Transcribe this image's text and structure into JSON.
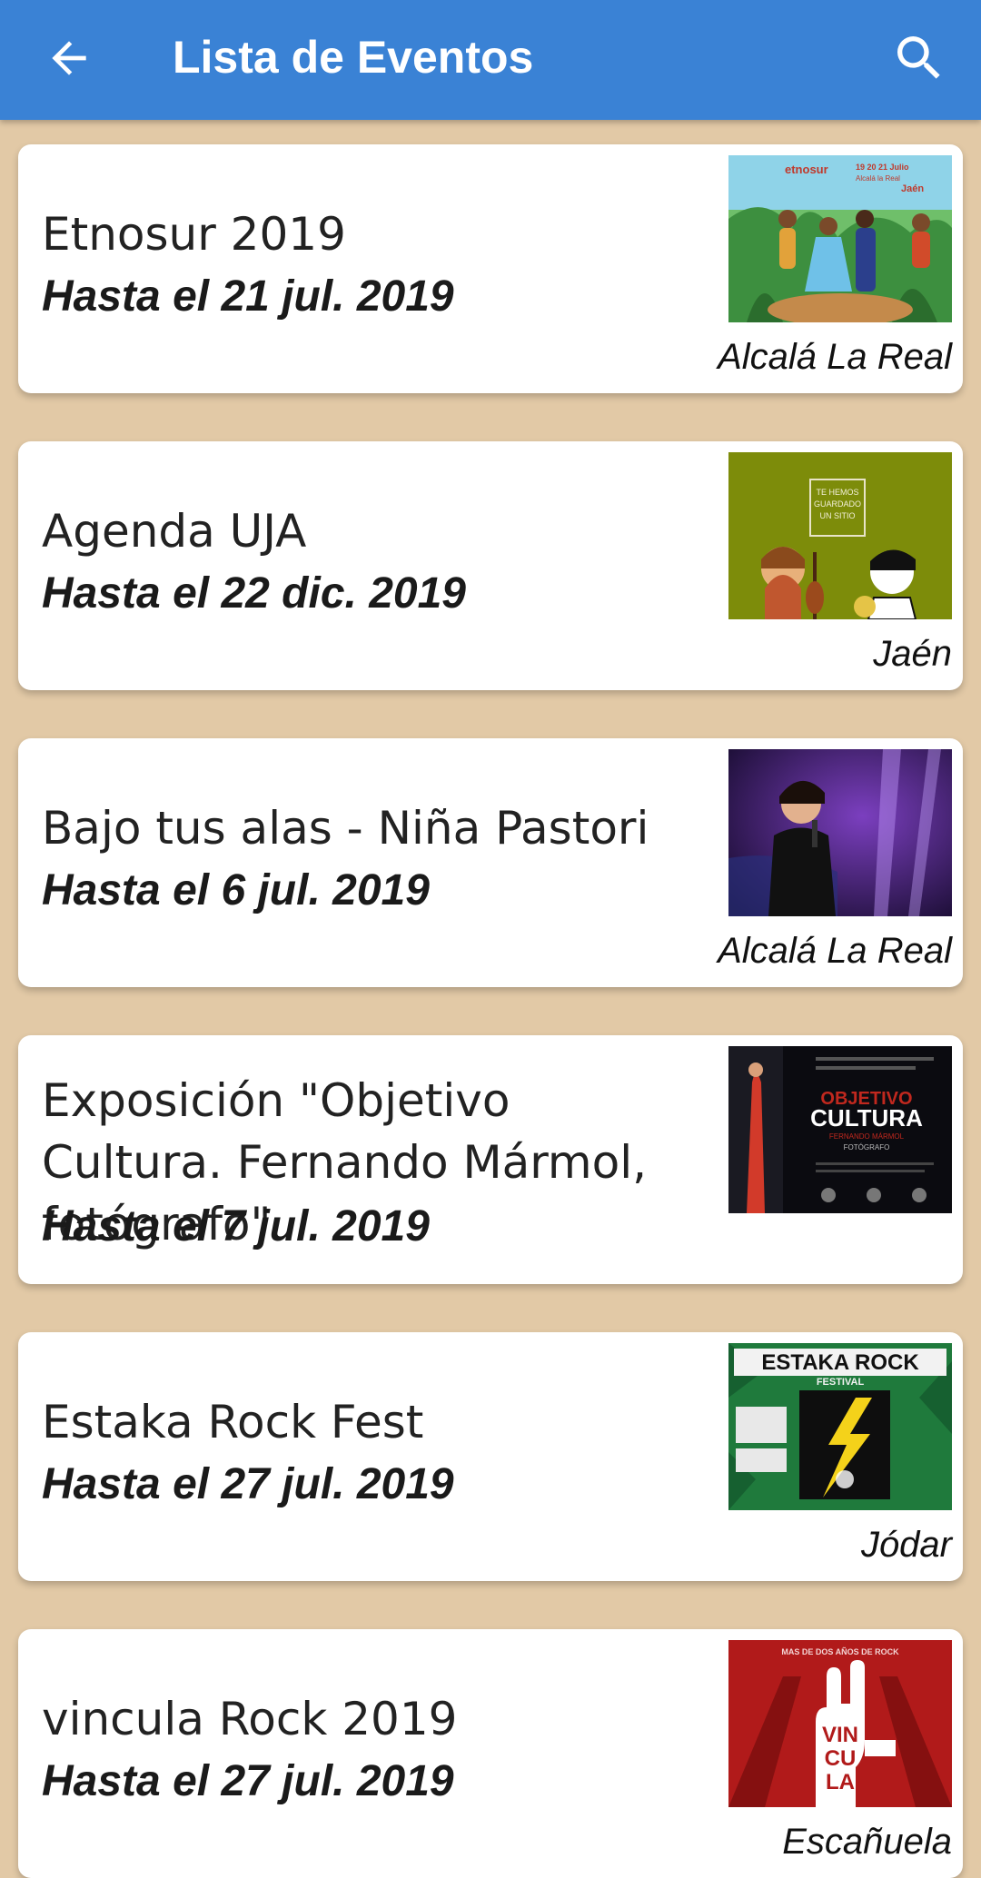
{
  "appbar": {
    "title": "Lista de Eventos",
    "back_icon": "arrow-left-icon",
    "search_icon": "search-icon",
    "color": "#3a82d5"
  },
  "background_color": "#e2c9a6",
  "events": [
    {
      "name": "Etnosur 2019",
      "date": "Hasta el 21 jul. 2019",
      "place": "Alcalá La Real",
      "poster_text": [
        "etnosur",
        "19 20 21 Julio",
        "Alcalá la Real",
        "Jaén"
      ]
    },
    {
      "name": "Agenda UJA",
      "date": "Hasta el 22 dic. 2019",
      "place": "Jaén",
      "poster_text": [
        "TE HEMOS",
        "GUARDADO",
        "UN SITIO"
      ]
    },
    {
      "name": "Bajo tus alas - Niña Pastori",
      "date": "Hasta el 6 jul. 2019",
      "place": "Alcalá La Real",
      "poster_text": []
    },
    {
      "name": "Exposición \"Objetivo Cultura. Fernando Mármol, fotógrafo\"",
      "date": "Hasta el 7 jul. 2019",
      "place": "",
      "poster_text": [
        "OBJETIVO",
        "CULTURA",
        "FERNANDO MÁRMOL",
        "FOTÓGRAFO"
      ]
    },
    {
      "name": "Estaka Rock Fest",
      "date": "Hasta el 27 jul. 2019",
      "place": "Jódar",
      "poster_text": [
        "ESTAKA ROCK",
        "FESTIVAL"
      ]
    },
    {
      "name": "vincula Rock 2019",
      "date": "Hasta el 27 jul. 2019",
      "place": "Escañuela",
      "poster_text": [
        "MAS DE DOS AÑOS DE ROCK",
        "VIN",
        "CU",
        "LA"
      ]
    }
  ]
}
